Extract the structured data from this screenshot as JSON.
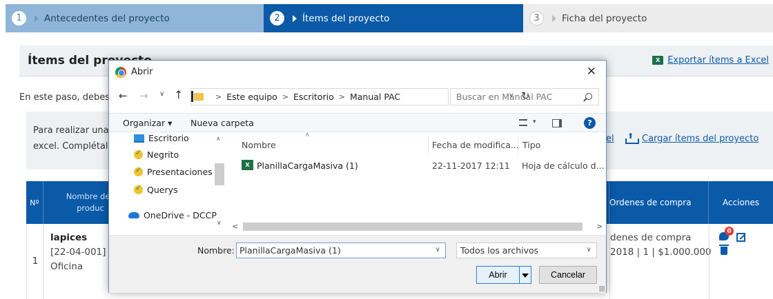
{
  "stepper": {
    "steps": [
      {
        "number": "1",
        "label": "Antecedentes del proyecto",
        "state": "done"
      },
      {
        "number": "2",
        "label": "Ítems del proyecto",
        "state": "active"
      },
      {
        "number": "3",
        "label": "Ficha del proyecto",
        "state": "pending"
      }
    ]
  },
  "section": {
    "title": "Ítems del proyecto",
    "export_label": "Exportar ítems a Excel"
  },
  "intro_text": "En este paso, debes a",
  "info": {
    "line1": "Para realizar una c",
    "line2": "excel. Complétala",
    "link_fragment": "el",
    "upload_label": "Cargar ítems del proyecto"
  },
  "table": {
    "headers": {
      "number": "Nº",
      "name_line1": "Nombre de l",
      "name_line2": "produc",
      "orders": "Ordenes de compra",
      "actions": "Acciones"
    },
    "rows": [
      {
        "number": "1",
        "name": "lapices",
        "code": "[22-04-001] I",
        "category": "Oficina",
        "orders_line1": "denes de compra",
        "orders_line2": "2018 | 1 | $1.000.000",
        "comment_count": "0"
      }
    ]
  },
  "dialog": {
    "title": "Abrir",
    "close_glyph": "✕",
    "breadcrumb": [
      "Este equipo",
      "Escritorio",
      "Manual PAC"
    ],
    "search_placeholder": "Buscar en Manual PAC",
    "toolbar": {
      "organize_label": "Organizar ▾",
      "new_folder_label": "Nueva carpeta"
    },
    "sidebar_items": [
      {
        "label": "Escritorio",
        "icon": "desktop-icon"
      },
      {
        "label": "Negrito",
        "icon": "sync-folder-icon"
      },
      {
        "label": "Presentaciones",
        "icon": "sync-folder-icon"
      },
      {
        "label": "Querys",
        "icon": "sync-folder-icon"
      },
      {
        "label": "OneDrive - DCCP",
        "icon": "onedrive-icon"
      }
    ],
    "columns": {
      "name": "Nombre",
      "date": "Fecha de modifica...",
      "type": "Tipo"
    },
    "files": [
      {
        "name": "PlanillaCargaMasiva (1)",
        "date": "22-11-2017 12:11",
        "type": "Hoja de cálculo d..."
      }
    ],
    "filename_label": "Nombre:",
    "filename_value": "PlanillaCargaMasiva (1)",
    "filetype_value": "Todos los archivos",
    "open_label": "Abrir",
    "cancel_label": "Cancelar"
  },
  "colors": {
    "primary": "#0a5aa8",
    "step_done": "#8fb6d8",
    "excel_green": "#1e7145",
    "badge_red": "#e53935"
  }
}
